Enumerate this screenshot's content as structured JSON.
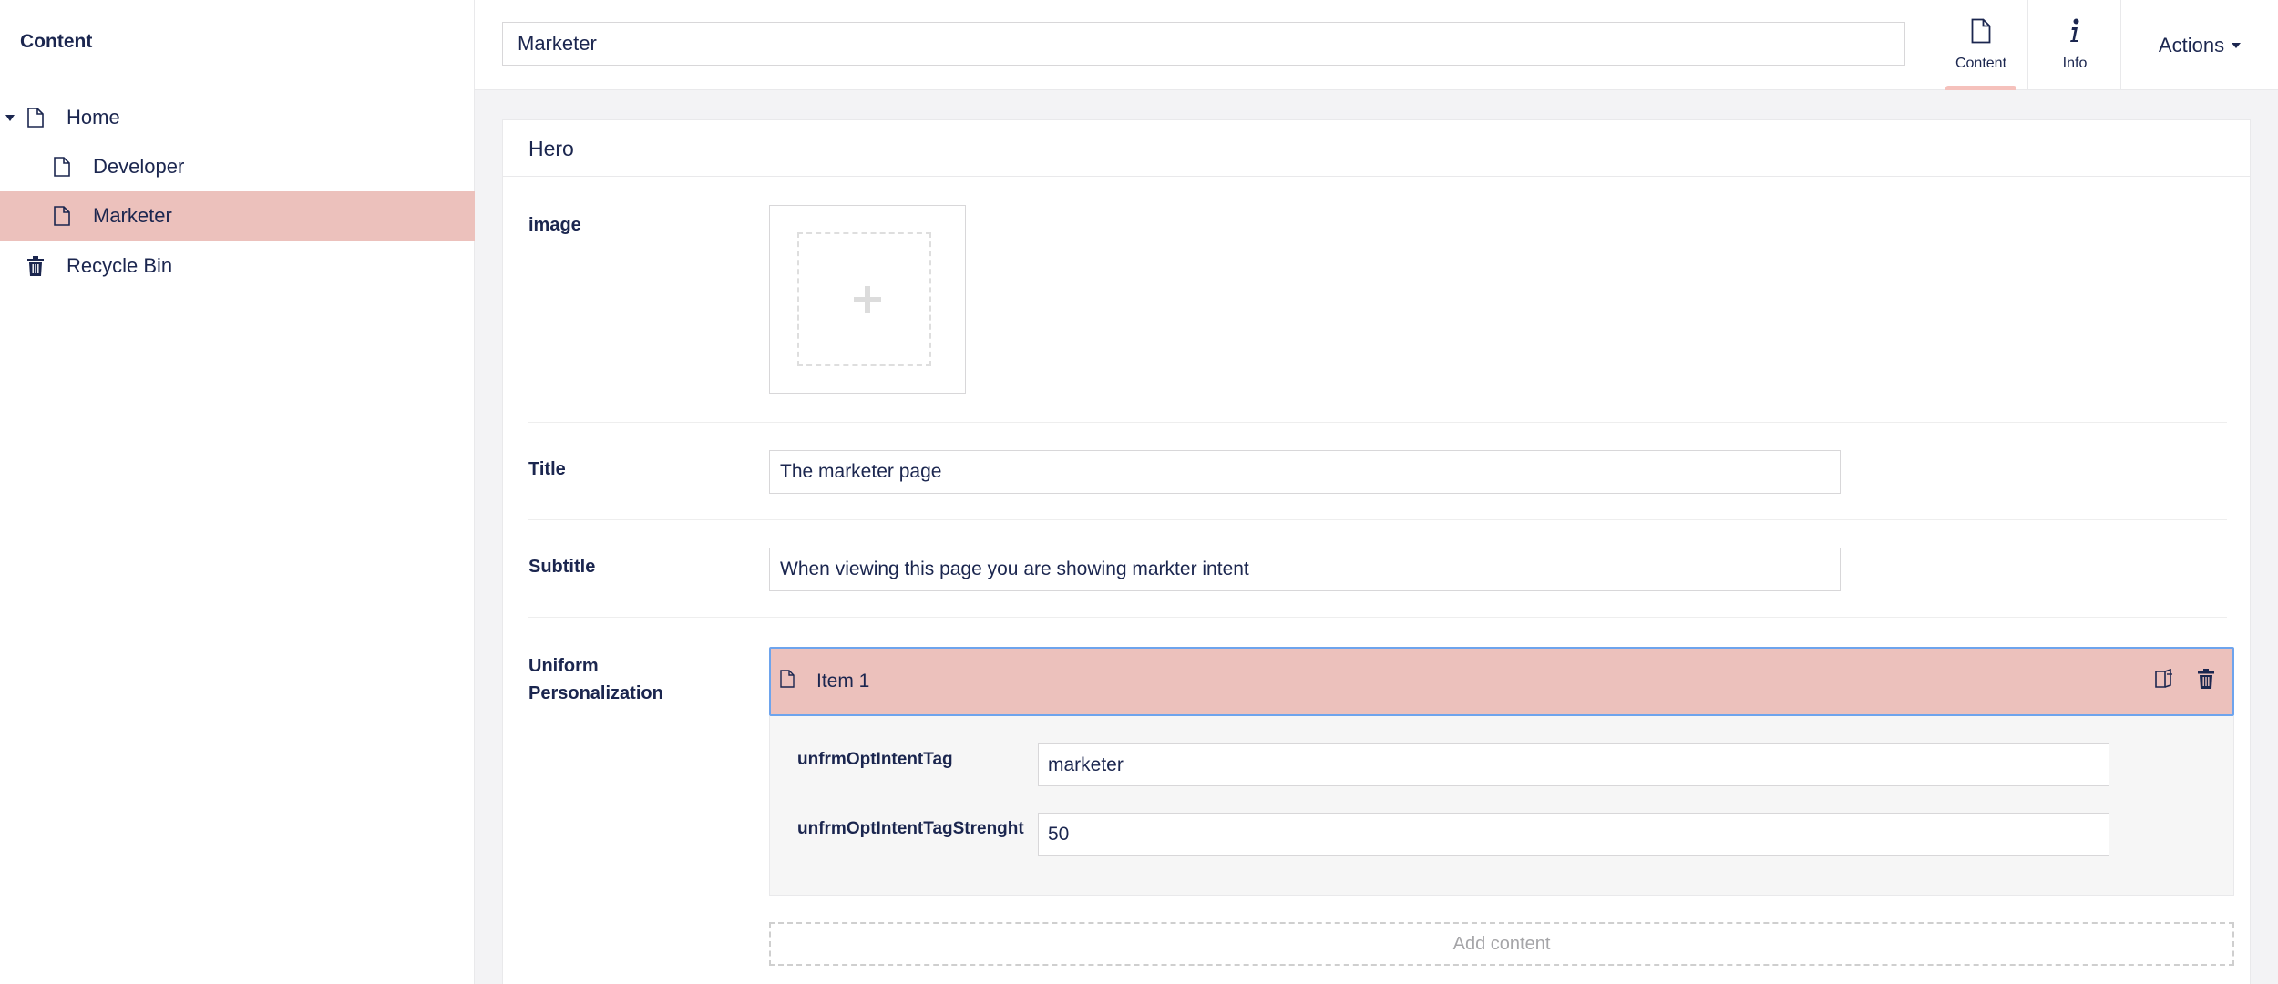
{
  "sidebar": {
    "title": "Content",
    "items": [
      {
        "label": "Home",
        "icon": "document-icon",
        "expanded": true
      },
      {
        "label": "Developer",
        "icon": "document-icon"
      },
      {
        "label": "Marketer",
        "icon": "document-icon",
        "selected": true
      },
      {
        "label": "Recycle Bin",
        "icon": "trash-icon"
      }
    ]
  },
  "header": {
    "name_value": "Marketer",
    "tabs": [
      {
        "label": "Content",
        "icon": "document-icon",
        "active": true
      },
      {
        "label": "Info",
        "icon": "info-icon"
      }
    ],
    "actions_label": "Actions"
  },
  "group": {
    "title": "Hero",
    "properties": {
      "image_label": "image",
      "title_label": "Title",
      "title_value": "The marketer page",
      "subtitle_label": "Subtitle",
      "subtitle_value": "When viewing this page you are showing markter intent",
      "personalization_label": "Uniform Personalization"
    },
    "block": {
      "item_label": "Item 1",
      "fields": [
        {
          "label": "unfrmOptIntentTag",
          "value": "marketer"
        },
        {
          "label": "unfrmOptIntentTagStrenght",
          "value": "50"
        }
      ],
      "add_content_label": "Add content"
    }
  },
  "colors": {
    "text": "#1b264f",
    "selected_bg": "#ecc1bc",
    "active_tab_indicator": "#f5c1bc",
    "block_focus_border": "#6ea4ed",
    "main_bg": "#f3f3f5"
  }
}
